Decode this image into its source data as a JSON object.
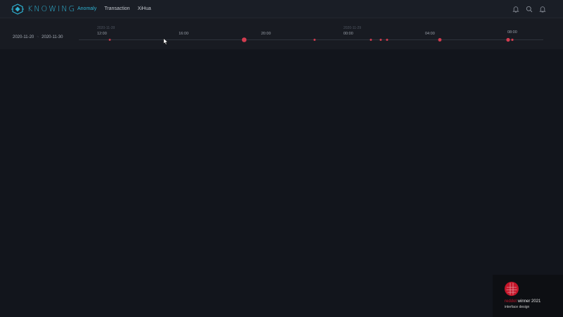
{
  "app": {
    "logo_text": "KNOWING"
  },
  "nav": {
    "items": [
      {
        "label": "Anomaly",
        "active": true
      },
      {
        "label": "Transaction",
        "active": false
      },
      {
        "label": "XiHua",
        "active": false
      }
    ],
    "icons": [
      "bell-icon",
      "search-icon",
      "notification-icon"
    ]
  },
  "timeline": {
    "range_start": "2020-11-20",
    "range_separator": "~",
    "range_end": "2020-11-30",
    "date_labels": [
      "2020-11-28",
      "2020-11-29"
    ],
    "time_ticks": [
      "12:00",
      "16:00",
      "20:00",
      "00:00",
      "04:00",
      "08:00"
    ],
    "events_count": 11
  },
  "award": {
    "brand_red": "red",
    "brand_dot": "dot",
    "winner_text": " winner 2021",
    "category": "interface design"
  },
  "colors": {
    "accent": "#2fb3d3",
    "event": "#d23c4f",
    "background": "#12151c"
  }
}
